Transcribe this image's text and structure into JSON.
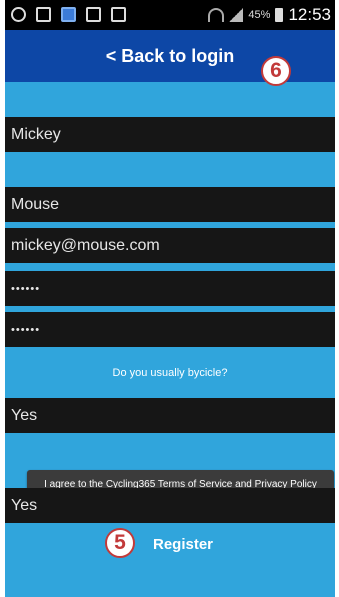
{
  "status_bar": {
    "battery_percent": "45%",
    "time": "12:53",
    "icons": [
      "location-icon",
      "image-icon",
      "weather-icon",
      "message-icon",
      "download-icon",
      "wifi-icon",
      "signal-icon",
      "battery-icon"
    ]
  },
  "header": {
    "back_label": "< Back to login"
  },
  "annotations": {
    "back_badge": "6",
    "register_badge": "5"
  },
  "form": {
    "first_name": "Mickey",
    "last_name": "Mouse",
    "email": "mickey@mouse.com",
    "password": "••••••",
    "confirm_password": "••••••",
    "cycling_question": "Do you usually bycicle?",
    "cycling_answer": "Yes",
    "terms_button": "I agree to the Cycling365 Terms of Service and Privacy Policy",
    "terms_answer": "Yes",
    "register_label": "Register"
  },
  "colors": {
    "background": "#30a5dc",
    "header": "#0d47a6",
    "field": "#161616",
    "badge_border": "#c23a3a"
  }
}
